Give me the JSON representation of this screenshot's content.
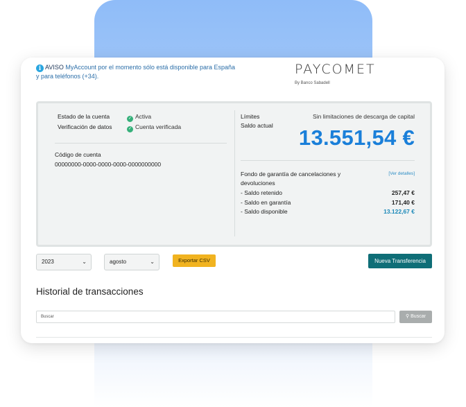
{
  "notice": {
    "label": "AVISO",
    "text": " MyAccount por el momento sólo está disponible para España y para teléfonos (+34)."
  },
  "brand": {
    "logo": "PAYCOMET",
    "sub": "By Banco Sabadell"
  },
  "account": {
    "status_label": "Estado de la cuenta",
    "status_value": "Activa",
    "verification_label": "Verificación de datos",
    "verification_value": "Cuenta verificada",
    "code_label": "Código de cuenta",
    "code_value": "00000000-0000-0000-0000-0000000000"
  },
  "balance": {
    "limits_label": "Límites",
    "limits_value": "Sin limitaciones de descarga de capital",
    "current_label": "Saldo actual",
    "current_value": "13.551,54 €",
    "guarantee_label": "Fondo de garantía de cancelaciones y devoluciones",
    "details_link": "[Ver detalles]",
    "retained_label": "- Saldo retenido",
    "retained_value": "257,47 €",
    "guarantee_balance_label": "- Saldo en garantía",
    "guarantee_balance_value": "171,40 €",
    "available_label": "- Saldo disponible",
    "available_value": "13.122,67 €"
  },
  "filters": {
    "year": "2023",
    "month": "agosto",
    "export_label": "Exportar CSV",
    "new_transfer_label": "Nueva Transferencia"
  },
  "history": {
    "title": "Historial de transacciones",
    "search_placeholder": "Buscar",
    "search_button": "Buscar"
  },
  "colors": {
    "accent_blue": "#1a7fd9",
    "teal_button": "#0f6e77",
    "csv_button": "#f1b320",
    "success_green": "#35b07a"
  }
}
